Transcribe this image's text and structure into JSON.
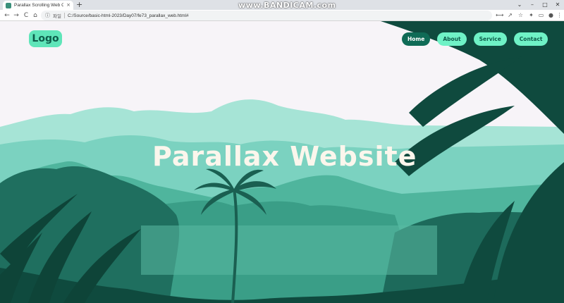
{
  "browser": {
    "tab_title": "Parallax Scrolling Web Cloning",
    "tab_close": "×",
    "new_tab": "+",
    "watermark": "www.BANDICAM.com",
    "window_controls": [
      "⌄",
      "–",
      "□",
      "✕"
    ],
    "nav_buttons": [
      "←",
      "→",
      "C",
      "⌂"
    ],
    "address_info_icon": "ⓘ",
    "address_scheme": "파일",
    "address_url": "C:/Source/basic-html-2023/Day07/fe73_parallax_web.html#",
    "toolbar_icons": [
      "translate-icon",
      "share-icon",
      "star-icon",
      "extensions-icon",
      "sidebar-icon",
      "profile-icon",
      "menu-icon"
    ],
    "toolbar_glyphs": [
      "⟷",
      "↗",
      "☆",
      "✦",
      "▭",
      "●",
      "⋮"
    ]
  },
  "page": {
    "logo": "Logo",
    "nav": [
      {
        "label": "Home",
        "active": true
      },
      {
        "label": "About",
        "active": false
      },
      {
        "label": "Service",
        "active": false
      },
      {
        "label": "Contact",
        "active": false
      }
    ],
    "hero_title": "Parallax Website"
  },
  "colors": {
    "page_background": "#f7f4f8",
    "far_mountains": "#9fe0d2",
    "mid_mountains": "#6fcfbd",
    "near_hills": "#3fa890",
    "foreground": "#0f4a3e",
    "logo_bg": "#5fe5b9",
    "nav_active_bg": "#0f6b56",
    "nav_bg": "#6ff2c6",
    "title_color": "#fbf6ec"
  }
}
